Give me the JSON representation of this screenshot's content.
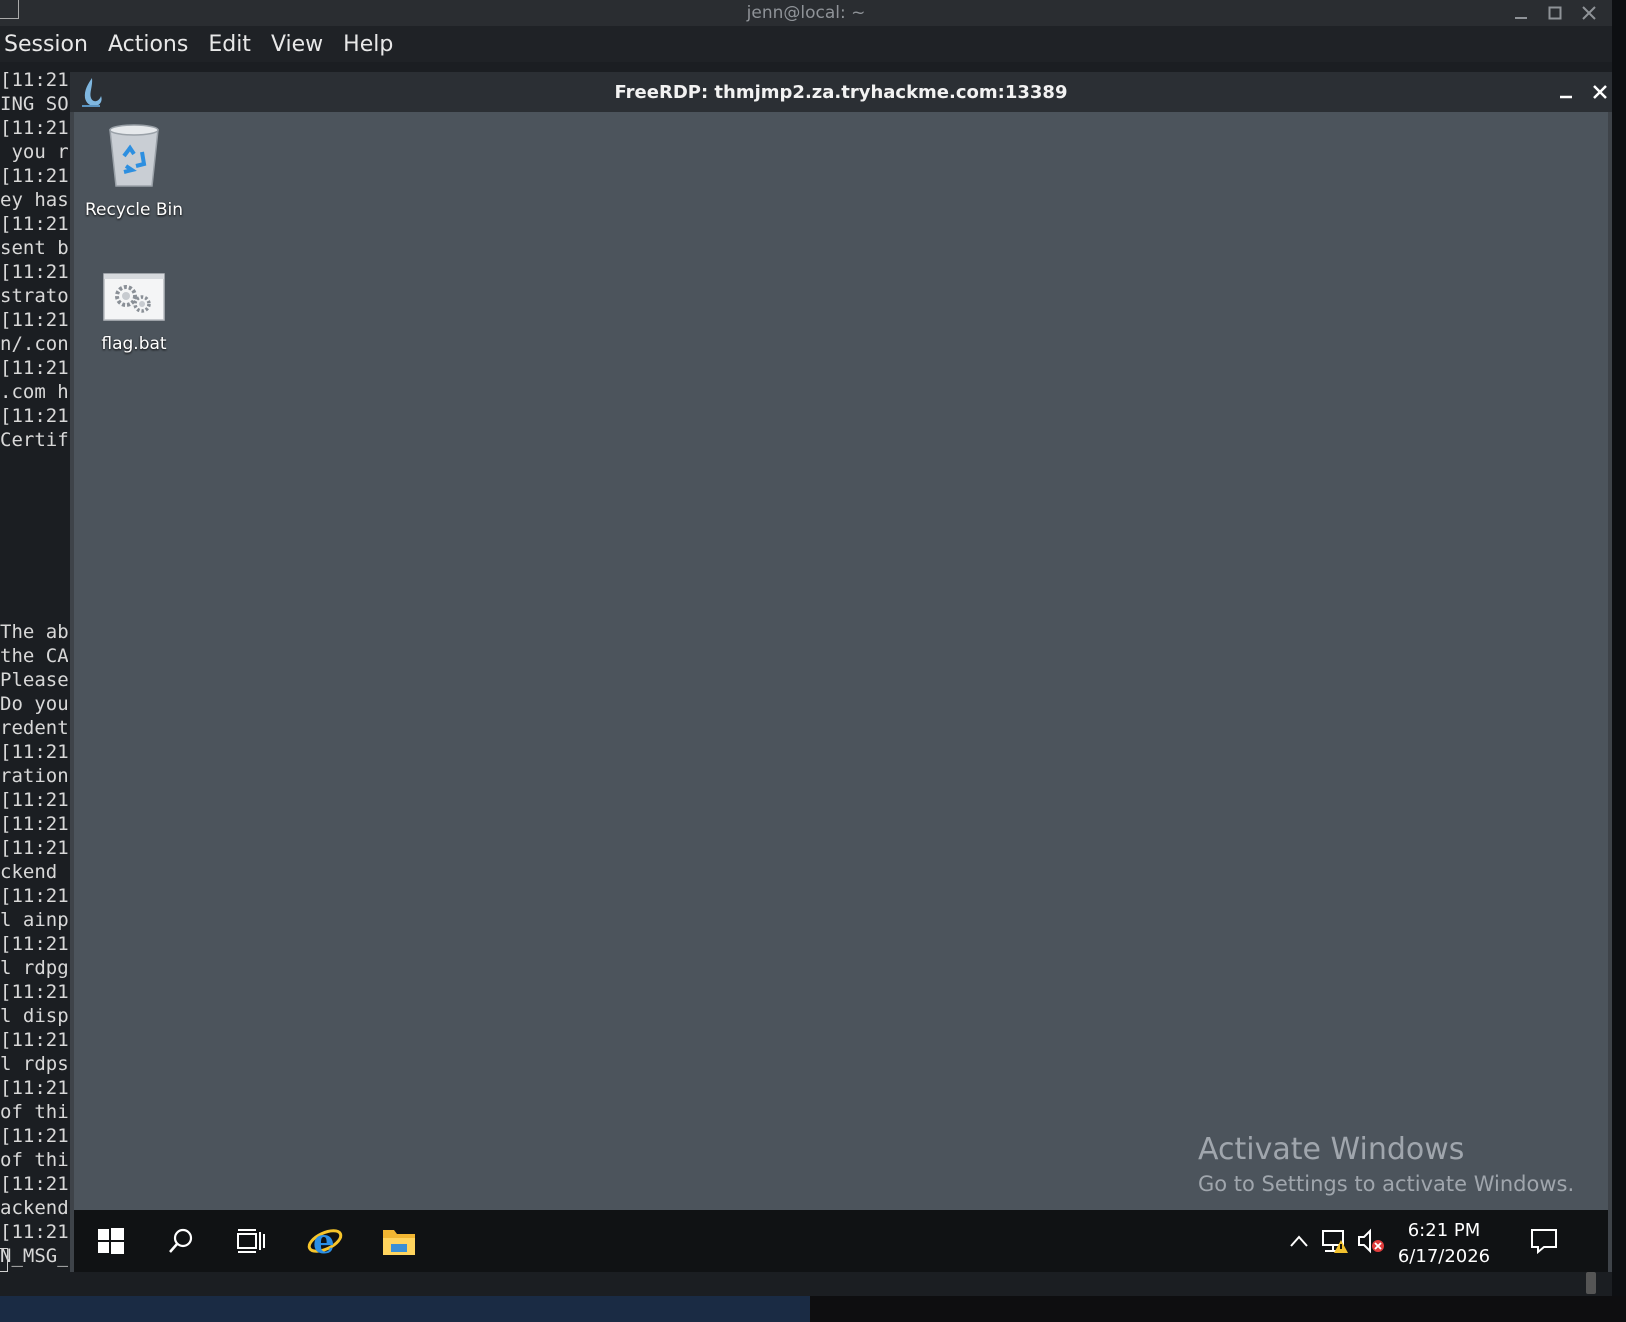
{
  "terminal": {
    "title": "jenn@local: ~",
    "menu": [
      "Session",
      "Actions",
      "Edit",
      "View",
      "Help"
    ],
    "lines": [
      "[11:21",
      "ING SO",
      "[11:21",
      " you r",
      "[11:21",
      "ey has",
      "[11:21",
      "sent b",
      "[11:21",
      "strato",
      "[11:21",
      "n/.con",
      "[11:21",
      ".com h",
      "[11:21",
      "Certif",
      "",
      "",
      "",
      "",
      "",
      "",
      "",
      "The ab",
      "the CA",
      "Please",
      "Do you",
      "redent",
      "[11:21",
      "ration",
      "[11:21",
      "[11:21",
      "[11:21",
      "ckend",
      "[11:21",
      "l ainp",
      "[11:21",
      "l rdpg",
      "[11:21",
      "l disp",
      "[11:21",
      "l rdps",
      "[11:21",
      "of thi",
      "[11:21",
      "of thi",
      "[11:21",
      "ackend",
      "[11:21",
      "N_MSG_"
    ]
  },
  "rdp": {
    "title": "FreeRDP: thmjmp2.za.tryhackme.com:13389"
  },
  "desktop": {
    "icons": [
      {
        "label": "Recycle Bin",
        "icon": "recycle-bin-icon"
      },
      {
        "label": "flag.bat",
        "icon": "batch-file-icon"
      }
    ],
    "watermark_title": "Activate Windows",
    "watermark_subtitle": "Go to Settings to activate Windows."
  },
  "taskbar": {
    "time": "6:21 PM",
    "date": "6/17/2026",
    "icons": [
      "windows-start-icon",
      "search-icon",
      "task-view-icon",
      "internet-explorer-icon",
      "file-explorer-icon",
      "tray-chevron-icon",
      "network-warning-icon",
      "volume-muted-icon",
      "action-center-icon"
    ]
  },
  "colors": {
    "desktop_bg": "#4c545c",
    "rdp_titlebar": "#2b2f34",
    "taskbar_bg": "#101214",
    "terminal_bg": "#1b1e22"
  }
}
